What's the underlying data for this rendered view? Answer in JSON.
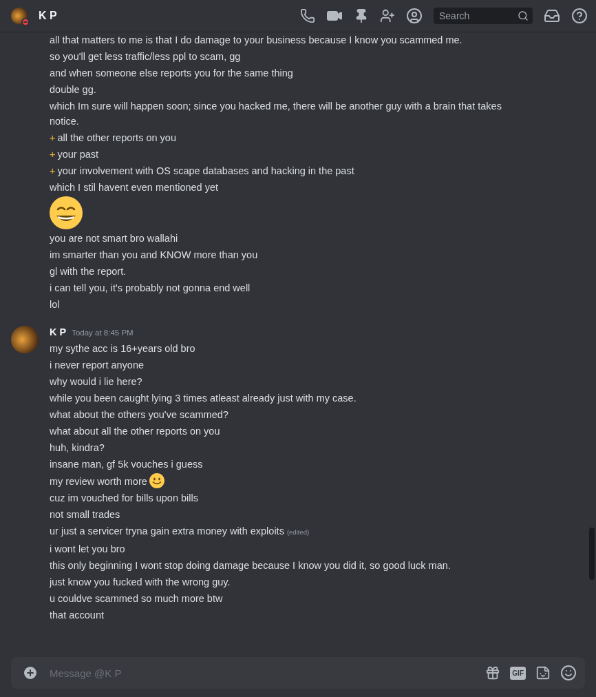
{
  "header": {
    "name": "K P",
    "do_not_disturb": true,
    "search": {
      "placeholder": "Search"
    }
  },
  "messages": [
    {
      "lines": [
        {
          "kind": "text",
          "text": "all that matters to me is that I do damage to your business because I know you scammed me."
        },
        {
          "kind": "text",
          "text": "so you'll get less traffic/less ppl to scam, gg"
        },
        {
          "kind": "text",
          "text": "and when someone else reports you for the same thing"
        },
        {
          "kind": "text",
          "text": "double gg."
        },
        {
          "kind": "text",
          "text": "which Im sure will happen soon; since you hacked me, there will be another guy with a brain that takes notice."
        },
        {
          "kind": "text",
          "bullet": "+",
          "text": "all the other reports on you"
        },
        {
          "kind": "text",
          "bullet": "+",
          "text": "your past"
        },
        {
          "kind": "text",
          "bullet": "+",
          "text": "your involvement with OS scape databases and hacking in the past"
        },
        {
          "kind": "text",
          "text": "which I stil havent even mentioned yet"
        },
        {
          "kind": "emoji"
        },
        {
          "kind": "text",
          "text": "you are not smart bro wallahi"
        },
        {
          "kind": "text",
          "text": "im smarter than you and KNOW more than you"
        },
        {
          "kind": "text",
          "text": "gl with the report."
        },
        {
          "kind": "text",
          "text": "i can tell you, it's probably not gonna end well"
        },
        {
          "kind": "text",
          "text": "lol"
        }
      ]
    },
    {
      "author": {
        "name": "K P",
        "timestamp": "Today at 8:45 PM"
      },
      "lines": [
        {
          "kind": "text",
          "text": "my sythe acc is 16+years old bro"
        },
        {
          "kind": "text",
          "text": "i never report anyone"
        },
        {
          "kind": "text",
          "text": "why would i lie here?"
        },
        {
          "kind": "text",
          "text": "while you been caught lying 3 times atleast already just with my case."
        },
        {
          "kind": "text",
          "text": "what about the others you've scammed?"
        },
        {
          "kind": "text",
          "text": "what about all the other reports on you"
        },
        {
          "kind": "text",
          "text": "huh, kindra?"
        },
        {
          "kind": "text",
          "text": "insane man, gf 5k vouches i guess"
        },
        {
          "kind": "text",
          "text": "my review worth more",
          "trailing_emoji": true
        },
        {
          "kind": "text",
          "text": "cuz im vouched for bills upon bills"
        },
        {
          "kind": "text",
          "text": "not small trades"
        },
        {
          "kind": "text",
          "text": "ur just a servicer tryna gain extra money with exploits",
          "edited": "(edited)"
        },
        {
          "kind": "text",
          "text": "i wont let you bro"
        },
        {
          "kind": "text",
          "text": "this only beginning I wont stop doing damage because I know you did it, so good luck man."
        },
        {
          "kind": "text",
          "text": "just know you fucked with the wrong guy."
        },
        {
          "kind": "text",
          "text": "u couldve scammed so much more btw"
        },
        {
          "kind": "text",
          "text": "that account"
        }
      ]
    }
  ],
  "composer": {
    "placeholder": "Message @K P",
    "gif_label": "GIF"
  }
}
